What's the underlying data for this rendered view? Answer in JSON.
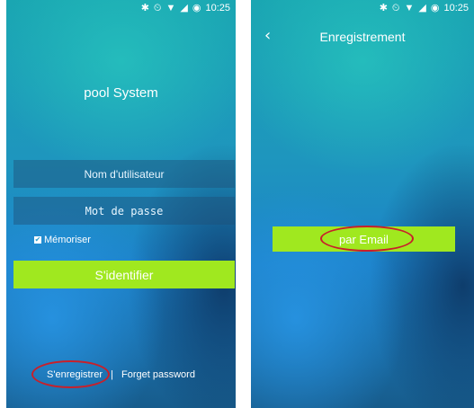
{
  "status_bar": {
    "time": "10:25",
    "icons": [
      "bluetooth-icon",
      "alarm-icon",
      "wifi-icon",
      "signal-icon",
      "battery-icon"
    ]
  },
  "login_screen": {
    "app_title": "pool System",
    "username_placeholder": "Nom d'utilisateur",
    "password_placeholder": "Mot de passe",
    "remember_label": "Mémoriser",
    "remember_checked": true,
    "login_button": "S'identifier",
    "register_link": "S'enregistrer",
    "separator": "|",
    "forgot_link": "Forget password"
  },
  "register_screen": {
    "title": "Enregistrement",
    "email_button": "par Email"
  },
  "colors": {
    "accent_green": "#a0e81f",
    "annotation_red": "#c8202a"
  }
}
